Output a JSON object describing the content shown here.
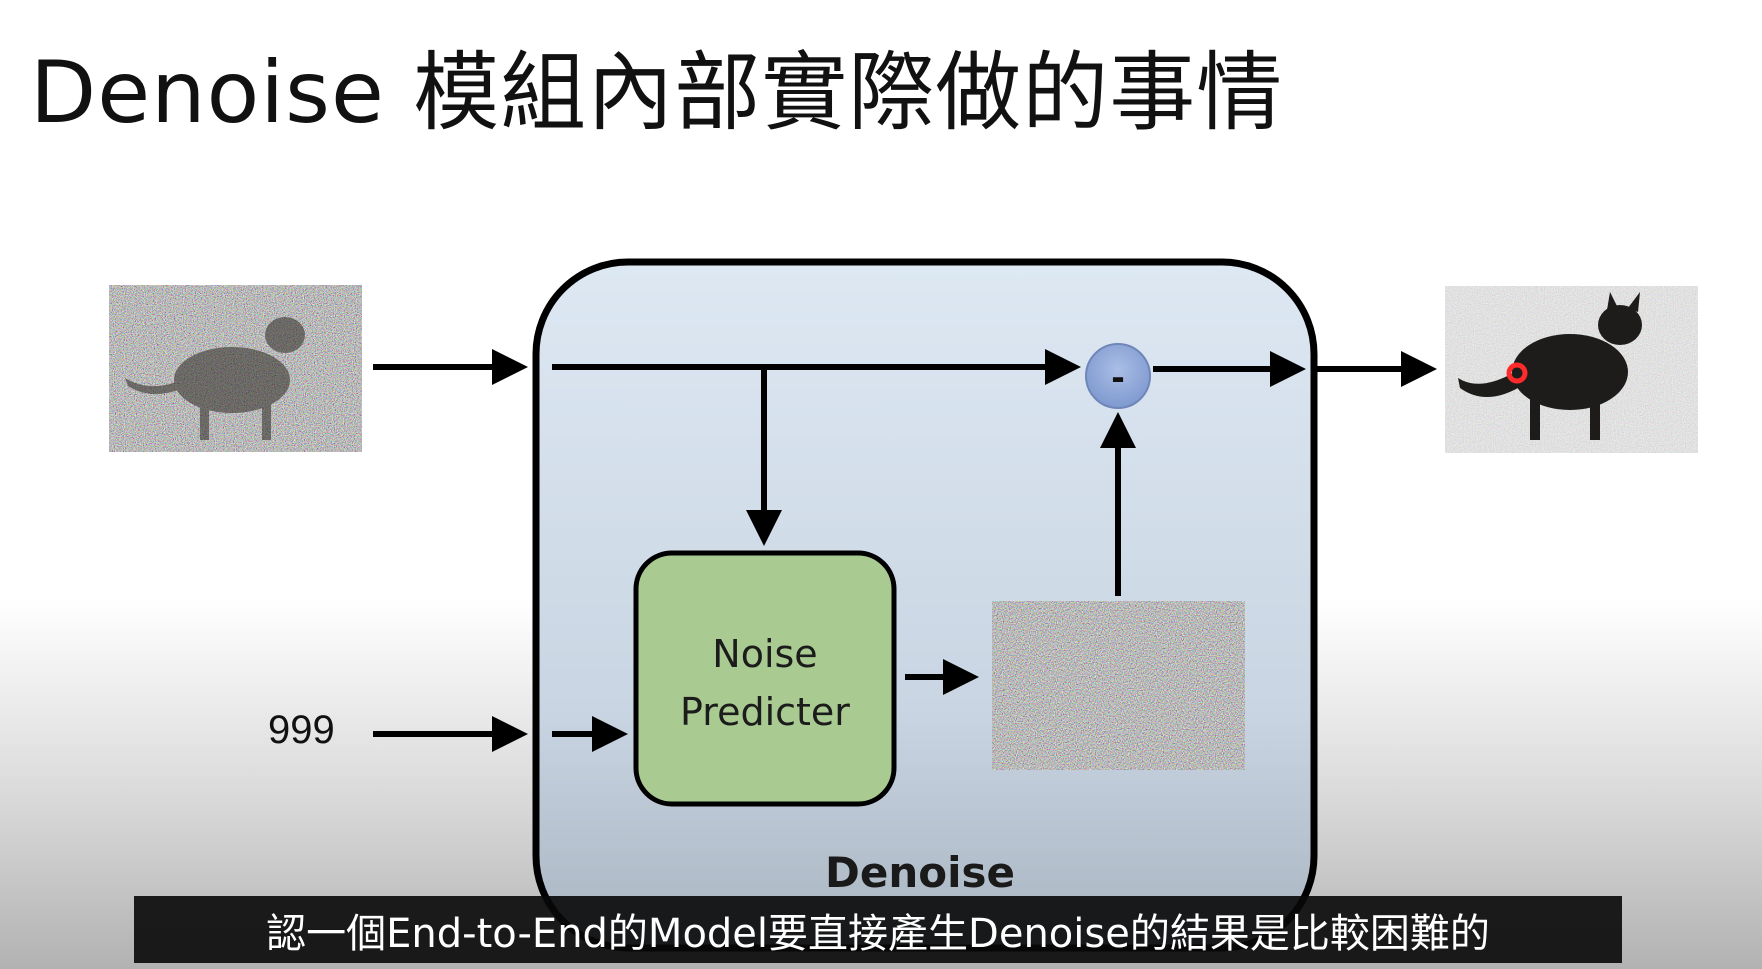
{
  "slide": {
    "title": "Denoise 模組內部實際做的事情"
  },
  "diagram": {
    "step_input": "999",
    "noise_predicter": {
      "line1": "Noise",
      "line2": "Predicter"
    },
    "denoise_block_label": "Denoise",
    "subtract_symbol": "-",
    "images": {
      "input": "noisy-cat-image",
      "predicted_noise": "noise-image",
      "output": "less-noisy-cat-image"
    },
    "colors": {
      "denoise_block_fill": "#dde8f3",
      "noise_predicter_fill": "#a9cb92",
      "subtract_node_fill": "#8ea9db"
    }
  },
  "caption": {
    "text": "認一個End-to-End的Model要直接產生Denoise的結果是比較困難的"
  }
}
